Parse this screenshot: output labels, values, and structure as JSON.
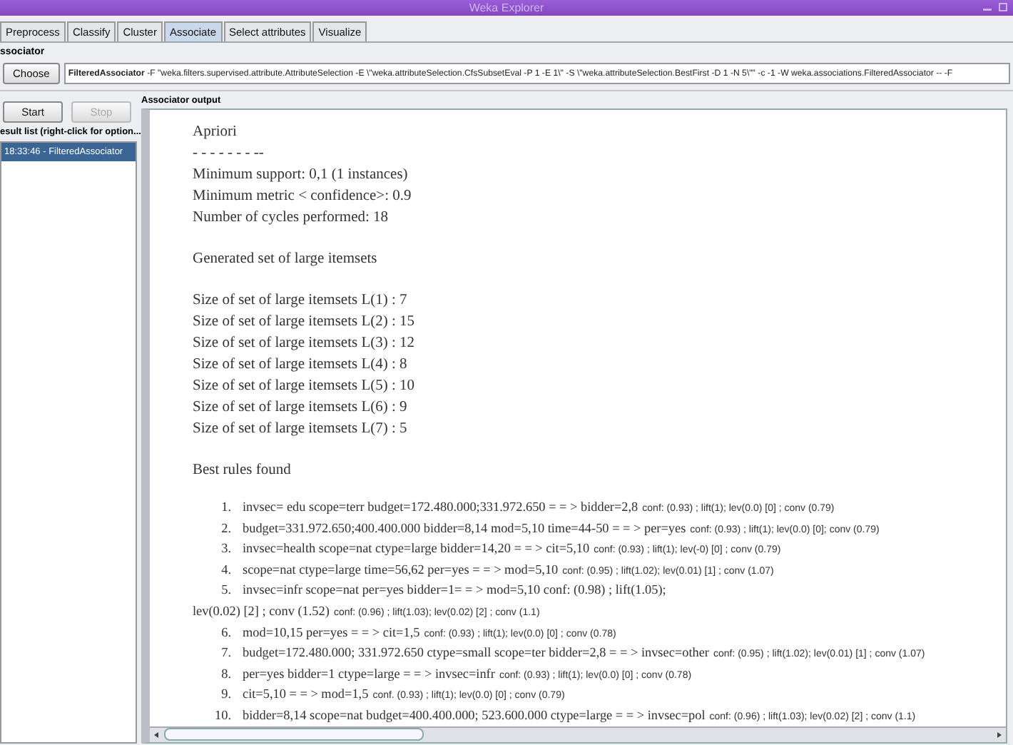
{
  "window": {
    "title": "Weka Explorer"
  },
  "tabs": [
    {
      "label": "Preprocess",
      "selected": false
    },
    {
      "label": "Classify",
      "selected": false
    },
    {
      "label": "Cluster",
      "selected": false
    },
    {
      "label": "Associate",
      "selected": true
    },
    {
      "label": "Select attributes",
      "selected": false
    },
    {
      "label": "Visualize",
      "selected": false
    }
  ],
  "associator": {
    "section_label": "ssociator",
    "choose_button": "Choose",
    "scheme": "**FilteredAssociator** -F \"weka.filters.supervised.attribute.AttributeSelection -E \\\"weka.attributeSelection.CfsSubsetEval -P 1 -E 1\\\" -S \\\"weka.attributeSelection.BestFirst -D 1 -N 5\\\"\" -c -1 -W weka.associations.FilteredAssociator -- -F"
  },
  "controls": [
    {
      "label": "Start",
      "disabled": false
    },
    {
      "label": "Stop",
      "disabled": true
    }
  ],
  "result_list": {
    "label": "esult list (right-click for option...",
    "items": [
      {
        "label": "18:33:46 - FilteredAssociator",
        "selected": true
      }
    ]
  },
  "output": {
    "label": "Associator output",
    "header": [
      [
        "Apriori",
        "- - - - - - - --",
        "Minimum support: 0,1 (1 instances)",
        "Minimum metric < confidence>: 0.9",
        "Number of cycles performed: 18"
      ],
      [
        "Generated set of large itemsets"
      ],
      [
        "Size of set of large itemsets L(1) : 7",
        "Size of set of large itemsets L(2) : 15",
        "Size of set of large itemsets L(3) : 12",
        "Size of set of large itemsets L(4) : 8",
        "Size of set of large itemsets L(5) : 10",
        "Size of set of large itemsets L(6) : 9",
        "Size of set of large itemsets L(7) : 5"
      ],
      [
        "Best rules found"
      ]
    ],
    "rules": [
      {
        "kind": "rule",
        "number": "1.",
        "text": "invsec= edu scope=terr budget=172.480.000;331.972.650 = = > bidder=2,8",
        "metrics": "conf: (0.93) ; lift(1); lev(0.0) [0] ; conv (0.79)"
      },
      {
        "kind": "rule",
        "number": "2.",
        "text": "budget=331.972.650;400.400.000 bidder=8,14 mod=5,10 time=44-50 = = > per=yes",
        "metrics": "conf: (0.93) ; lift(1); lev(0.0) [0]; conv (0.79)"
      },
      {
        "kind": "rule",
        "number": "3.",
        "text": "invsec=health scope=nat ctype=large bidder=14,20 = = > cit=5,10",
        "metrics": "conf: (0.93) ; lift(1); lev(-0) [0] ; conv (0.79)"
      },
      {
        "kind": "rule",
        "number": "4.",
        "text": "scope=nat ctype=large time=56,62 per=yes = = > mod=5,10",
        "metrics": "conf: (0.95) ; lift(1.02); lev(0.01) [1] ; conv (1.07)"
      },
      {
        "kind": "rule",
        "number": "5.",
        "text": "invsec=infr scope=nat per=yes bidder=1= = > mod=5,10 conf: (0.98) ; lift(1.05);"
      },
      {
        "kind": "continuation",
        "text": "lev(0.02) [2] ; conv (1.52)",
        "metrics": "conf: (0.96) ; lift(1.03); lev(0.02) [2] ; conv (1.1)"
      },
      {
        "kind": "rule",
        "number": "6.",
        "text": "mod=10,15 per=yes = = > cit=1,5",
        "metrics": "conf: (0.93) ; lift(1); lev(0.0) [0] ; conv (0.78)"
      },
      {
        "kind": "rule",
        "number": "7.",
        "text": "budget=172.480.000; 331.972.650 ctype=small scope=ter bidder=2,8 = = > invsec=other",
        "metrics": "conf: (0.95) ; lift(1.02); lev(0.01) [1] ; conv (1.07)"
      },
      {
        "kind": "rule",
        "number": "8.",
        "text": "per=yes bidder=1 ctype=large = = > invsec=infr",
        "metrics": "conf: (0.93) ; lift(1); lev(0.0) [0] ; conv (0.78)"
      },
      {
        "kind": "rule",
        "number": "9.",
        "text": "cit=5,10 = = > mod=1,5",
        "metrics": "conf. (0.93) ; lift(1); lev(0.0) [0] ; conv (0.79)"
      },
      {
        "kind": "rule",
        "number": "10.",
        "text": "bidder=8,14 scope=nat budget=400.400.000; 523.600.000 ctype=large = = > invsec=pol",
        "metrics": "conf: (0.96) ; lift(1.03); lev(0.02) [2] ; conv (1.1)"
      }
    ]
  }
}
